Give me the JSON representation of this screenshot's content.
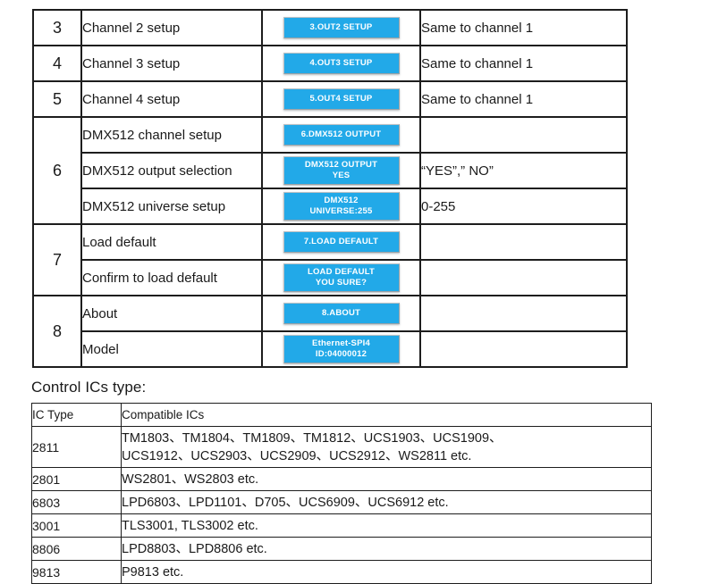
{
  "menu_table": {
    "rows": [
      {
        "num": "3",
        "num_rowspan": 1,
        "label": "Channel 2 setup",
        "button": "3.OUT2 SETUP",
        "note": "Same to channel 1"
      },
      {
        "num": "4",
        "num_rowspan": 1,
        "label": "Channel 3 setup",
        "button": "4.OUT3 SETUP",
        "note": "Same to channel 1"
      },
      {
        "num": "5",
        "num_rowspan": 1,
        "label": "Channel 4 setup",
        "button": "5.OUT4 SETUP",
        "note": "Same to channel 1"
      },
      {
        "num": "6",
        "num_rowspan": 3,
        "label": "DMX512 channel setup",
        "button": "6.DMX512 OUTPUT",
        "note": ""
      },
      {
        "num": "",
        "num_rowspan": 0,
        "label": "DMX512 output selection",
        "button": "DMX512 OUTPUT\nYES",
        "note": "“YES”,” NO”"
      },
      {
        "num": "",
        "num_rowspan": 0,
        "label": "DMX512 universe setup",
        "button": "DMX512\nUNIVERSE:255",
        "note": "0-255"
      },
      {
        "num": "7",
        "num_rowspan": 2,
        "label": "Load default",
        "button": "7.LOAD DEFAULT",
        "note": ""
      },
      {
        "num": "",
        "num_rowspan": 0,
        "label": "Confirm to load default",
        "button": "LOAD DEFAULT\nYOU SURE?",
        "note": ""
      },
      {
        "num": "8",
        "num_rowspan": 2,
        "label": "About",
        "button": "8.ABOUT",
        "note": ""
      },
      {
        "num": "",
        "num_rowspan": 0,
        "label": "Model",
        "button": "Ethernet-SPI4\nID:04000012",
        "note": ""
      }
    ]
  },
  "ics_section": {
    "title": "Control ICs type:",
    "headers": {
      "type": "IC Type",
      "list": "Compatible ICs"
    },
    "rows": [
      {
        "type": "2811",
        "list": "TM1803、TM1804、TM1809、TM1812、UCS1903、UCS1909、\nUCS1912、UCS2903、UCS2909、UCS2912、WS2811 etc.",
        "tall": true
      },
      {
        "type": "2801",
        "list": "WS2801、WS2803 etc.",
        "tall": false
      },
      {
        "type": "6803",
        "list": "LPD6803、LPD1101、D705、UCS6909、UCS6912 etc.",
        "tall": false
      },
      {
        "type": "3001",
        "list": "TLS3001, TLS3002 etc.",
        "tall": false
      },
      {
        "type": "8806",
        "list": "LPD8803、LPD8806 etc.",
        "tall": false
      },
      {
        "type": "9813",
        "list": "P9813 etc.",
        "tall": false
      }
    ]
  },
  "colors": {
    "lcd_blue": "#22a9e8",
    "lcd_text": "#ffffff",
    "border": "#1d1d1d"
  }
}
